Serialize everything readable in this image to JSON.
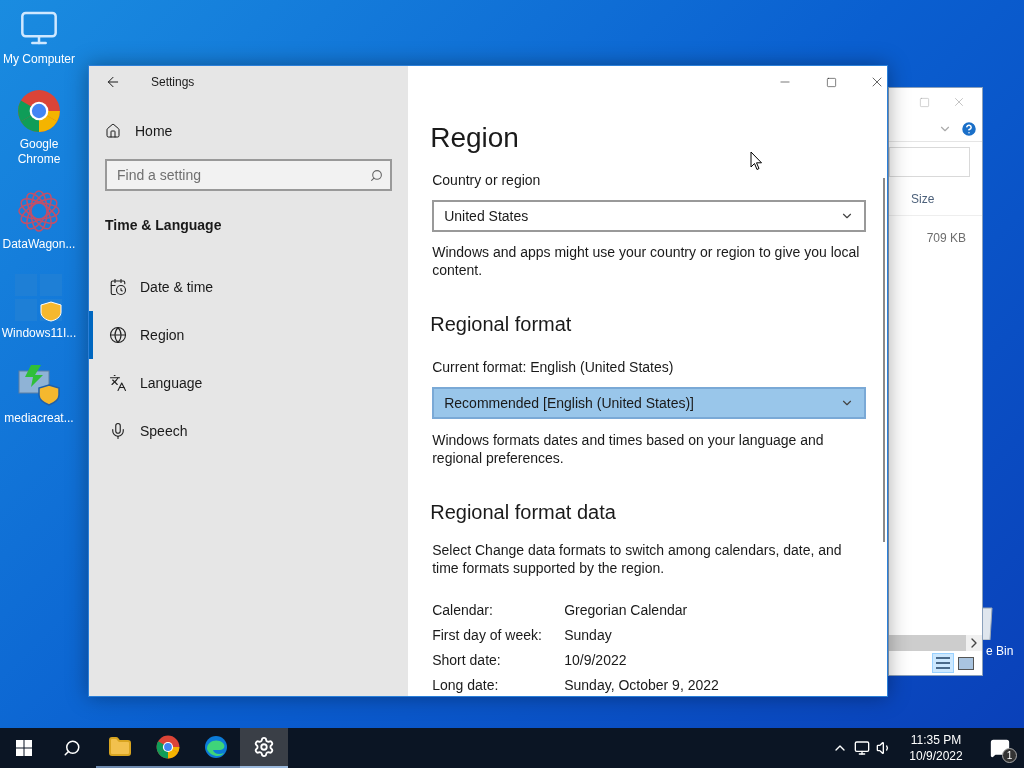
{
  "desktop_icons": [
    {
      "label": "My Computer",
      "kind": "computer"
    },
    {
      "label": "Google Chrome",
      "kind": "chrome"
    },
    {
      "label": "DataWagon...",
      "kind": "web"
    },
    {
      "label": "Windows11I...",
      "kind": "tiles"
    },
    {
      "label": "mediacreat...",
      "kind": "media"
    }
  ],
  "recycle_bin": {
    "label": "e Bin"
  },
  "explorer": {
    "column": "Size",
    "size": "709 KB"
  },
  "settings": {
    "title": "Settings",
    "home": "Home",
    "search": {
      "placeholder": "Find a setting"
    },
    "section": "Time & Language",
    "nav": [
      {
        "label": "Date & time",
        "kind": "clock",
        "selected": false
      },
      {
        "label": "Region",
        "kind": "globe",
        "selected": true
      },
      {
        "label": "Language",
        "kind": "language",
        "selected": false
      },
      {
        "label": "Speech",
        "kind": "mic",
        "selected": false
      }
    ],
    "page": {
      "title": "Region",
      "country_label": "Country or region",
      "country": {
        "value": "United States",
        "focused": false
      },
      "country_note": "Windows and apps might use your country or region to give you local content.",
      "format_heading": "Regional format",
      "current_format": "Current format: English (United States)",
      "format": {
        "value": "Recommended [English (United States)]",
        "focused": true
      },
      "format_note": "Windows formats dates and times based on your language and regional preferences.",
      "data_heading": "Regional format data",
      "data_note": "Select Change data formats to switch among calendars, date, and time formats supported by the region.",
      "rows": [
        {
          "label": "Calendar:",
          "value": "Gregorian Calendar"
        },
        {
          "label": "First day of week:",
          "value": "Sunday"
        },
        {
          "label": "Short date:",
          "value": "10/9/2022"
        },
        {
          "label": "Long date:",
          "value": "Sunday, October 9, 2022"
        }
      ]
    }
  },
  "taskbar": {
    "apps": [
      {
        "kind": "folder",
        "active": false
      },
      {
        "kind": "chrome",
        "active": false
      },
      {
        "kind": "edge",
        "active": false
      },
      {
        "kind": "settings",
        "active": true
      }
    ],
    "time": "11:35 PM",
    "date": "10/9/2022",
    "notifications": "1"
  }
}
